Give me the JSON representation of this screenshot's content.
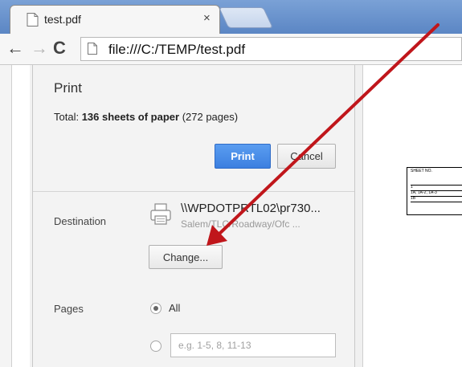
{
  "browser": {
    "tab_title": "test.pdf",
    "tab_close": "×",
    "url": "file:///C:/TEMP/test.pdf",
    "nav": {
      "back": "←",
      "forward": "→",
      "reload": "C"
    }
  },
  "print": {
    "title": "Print",
    "total_prefix": "Total: ",
    "total_sheets": "136 sheets of paper",
    "total_suffix": " (272 pages)",
    "print_button": "Print",
    "cancel_button": "Cancel",
    "destination": {
      "label": "Destination",
      "printer_name": "\\\\WPDOTPRTL02\\pr730...",
      "printer_location": "Salem/TLC/Roadway/Ofc ...",
      "change_button": "Change..."
    },
    "pages": {
      "label": "Pages",
      "option_all": "All",
      "selected": "All",
      "custom_placeholder": "e.g. 1-5, 8, 11-13"
    }
  },
  "preview": {
    "table_rows": [
      "SHEET NO.",
      "1",
      "1A, 1A-2, 1A-3",
      "1B"
    ]
  },
  "colors": {
    "print_button": "#3c7fe0",
    "annotation_arrow": "#c0161b"
  },
  "icons": [
    "file-icon",
    "printer-icon",
    "arrow-annotation"
  ]
}
